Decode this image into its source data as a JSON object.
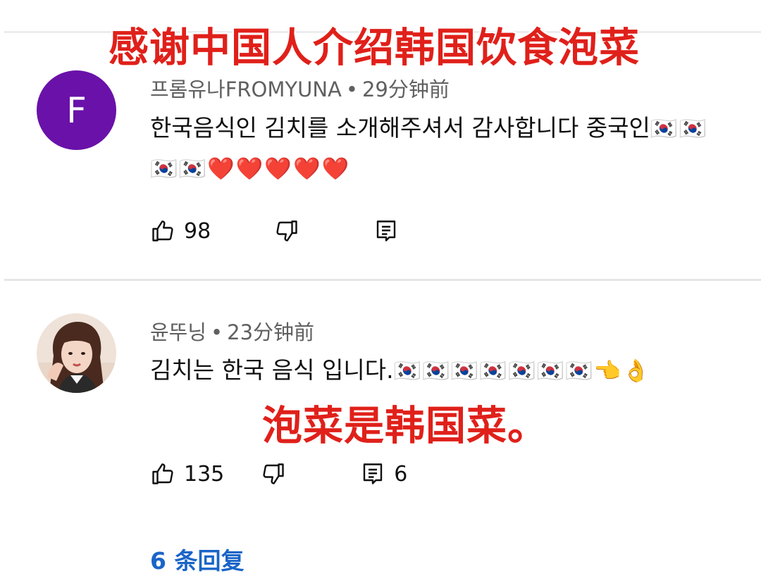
{
  "overlay": {
    "top_caption": "感谢中国人介绍韩国饮食泡菜",
    "mid_caption": "泡菜是韩国菜。"
  },
  "comments": [
    {
      "avatar_letter": "F",
      "author": "프롬유나FROMYUNA",
      "separator": "•",
      "time": "29分钟前",
      "text": "한국음식인 김치를 소개해주셔서 감사합니다 중국인",
      "emojis": "🇰🇷🇰🇷🇰🇷🇰🇷❤️❤️❤️❤️❤️",
      "likes": "98",
      "replies_count": ""
    },
    {
      "author": "윤뚜닝",
      "separator": "•",
      "time": "23分钟前",
      "text": "김치는 한국 음식 입니다.",
      "emojis": "🇰🇷🇰🇷🇰🇷🇰🇷🇰🇷🇰🇷🇰🇷👈👌",
      "likes": "135",
      "replies_count": "6"
    }
  ],
  "replies_link": "6 条回复",
  "icons": {
    "like": "thumbs-up-icon",
    "dislike": "thumbs-down-icon",
    "reply": "comment-icon"
  },
  "colors": {
    "overlay_red": "#e0201a",
    "avatar_purple": "#6a11a9",
    "link_blue": "#1a65c7"
  }
}
